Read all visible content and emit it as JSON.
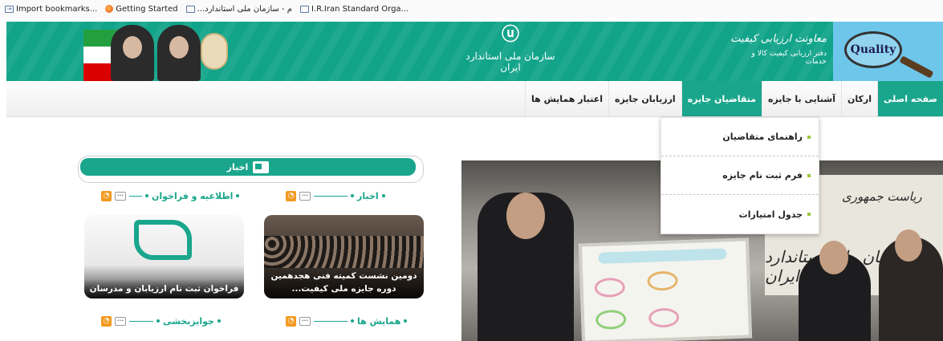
{
  "bookmarks_bar": {
    "items": [
      {
        "label": "Import bookmarks...",
        "icon": "import-icon"
      },
      {
        "label": "Getting Started",
        "icon": "firefox-icon"
      },
      {
        "label": "...م - سازمان ملی استاندارد",
        "icon": "page-icon"
      },
      {
        "label": "I.R.Iran Standard Orga...",
        "icon": "page-icon"
      }
    ]
  },
  "header": {
    "org_name": "سازمان ملی استاندارد ایران",
    "emblem_glyph": "ⓤ",
    "quality_title": "معاونت ارزیابی کیفیت",
    "quality_subtitle": "دفتر ارزیابی کیفیت کالا و خدمات",
    "quality_logo_text": "Quality",
    "accent_color": "#1aa68c"
  },
  "nav": {
    "items": [
      {
        "label": "صفحه اصلی",
        "state": "active"
      },
      {
        "label": "ارکان",
        "state": "normal"
      },
      {
        "label": "آشنایی با جایزه",
        "state": "normal"
      },
      {
        "label": "متقاضیان جایزه",
        "state": "hover"
      },
      {
        "label": "ارزیابان جایزه",
        "state": "normal"
      },
      {
        "label": "اعتبار همایش ها",
        "state": "normal"
      }
    ]
  },
  "dropdown": {
    "items": [
      {
        "label": "راهنمای متقاضیان"
      },
      {
        "label": "فرم ثبت نام جایزه"
      },
      {
        "label": "جدول امتیازات"
      }
    ]
  },
  "news_block": {
    "title": "اخبار",
    "sections": [
      {
        "title": "اخبار",
        "card_caption": "دومین نشست کمیته فنی هجدهمین دوره جایزه ملی کیفیت..."
      },
      {
        "title": "اطلاعیه و فراخوان",
        "card_caption": "فراخوان ثبت نام ارزیابان و مدرسان"
      },
      {
        "title": "همایش ها"
      },
      {
        "title": "جوایزبخشی"
      }
    ],
    "more_icon": "more-icon",
    "rss_icon": "rss-icon"
  },
  "main_photo": {
    "wall_text": "ریاست جمهوری",
    "wall_text_2": "سازمان ملی استاندارد ایران"
  }
}
